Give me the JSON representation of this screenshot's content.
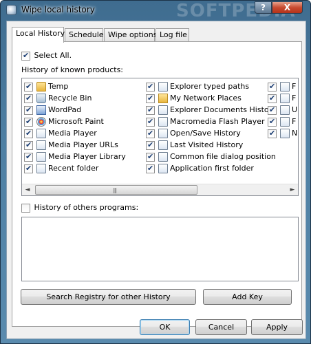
{
  "window": {
    "title": "Wipe local history",
    "watermark": "SOFTPEDIA",
    "help_glyph": "?",
    "close_glyph": "X"
  },
  "tabs": [
    {
      "label": "Local History",
      "active": true
    },
    {
      "label": "Schedule",
      "active": false
    },
    {
      "label": "Wipe options",
      "active": false
    },
    {
      "label": "Log file",
      "active": false
    }
  ],
  "local_history": {
    "select_all": {
      "label": "Select All.",
      "checked": true
    },
    "known_products_label": "History of known products:",
    "columns": [
      [
        {
          "label": "Temp",
          "icon": "folder-icon",
          "checked": true
        },
        {
          "label": "Recycle Bin",
          "icon": "recycle-bin-icon",
          "checked": true
        },
        {
          "label": "WordPad",
          "icon": "wordpad-icon",
          "checked": true
        },
        {
          "label": "Microsoft Paint",
          "icon": "paint-icon",
          "checked": true
        },
        {
          "label": "Media Player",
          "icon": "document-icon",
          "checked": true
        },
        {
          "label": "Media Player URLs",
          "icon": "document-icon",
          "checked": true
        },
        {
          "label": "Media Player Library",
          "icon": "document-icon",
          "checked": true
        },
        {
          "label": "Recent folder",
          "icon": "document-icon",
          "checked": true
        }
      ],
      [
        {
          "label": "Explorer typed paths",
          "icon": "document-icon",
          "checked": true
        },
        {
          "label": "My Network Places",
          "icon": "network-places-icon",
          "checked": true
        },
        {
          "label": "Explorer Documents History",
          "icon": "document-icon",
          "checked": true
        },
        {
          "label": "Macromedia Flash Player",
          "icon": "document-icon",
          "checked": true
        },
        {
          "label": "Open/Save History",
          "icon": "document-icon",
          "checked": true
        },
        {
          "label": "Last Visited History",
          "icon": "document-icon",
          "checked": true
        },
        {
          "label": "Common file dialog position",
          "icon": "document-icon",
          "checked": true
        },
        {
          "label": "Application first folder",
          "icon": "document-icon",
          "checked": true
        }
      ],
      [
        {
          "label": "F",
          "icon": "document-icon",
          "checked": true
        },
        {
          "label": "F",
          "icon": "document-icon",
          "checked": true
        },
        {
          "label": "U",
          "icon": "document-icon",
          "checked": true
        },
        {
          "label": "F",
          "icon": "document-icon",
          "checked": true
        },
        {
          "label": "N",
          "icon": "document-icon",
          "checked": true
        }
      ]
    ],
    "scroll": {
      "left_arrow": "◄",
      "right_arrow": "►",
      "grip": "|||"
    },
    "others": {
      "label": "History of others programs:",
      "checked": false
    },
    "search_button": "Search Registry for other  History",
    "add_key_button": "Add Key"
  },
  "footer": {
    "ok": "OK",
    "cancel": "Cancel",
    "apply": "Apply"
  }
}
